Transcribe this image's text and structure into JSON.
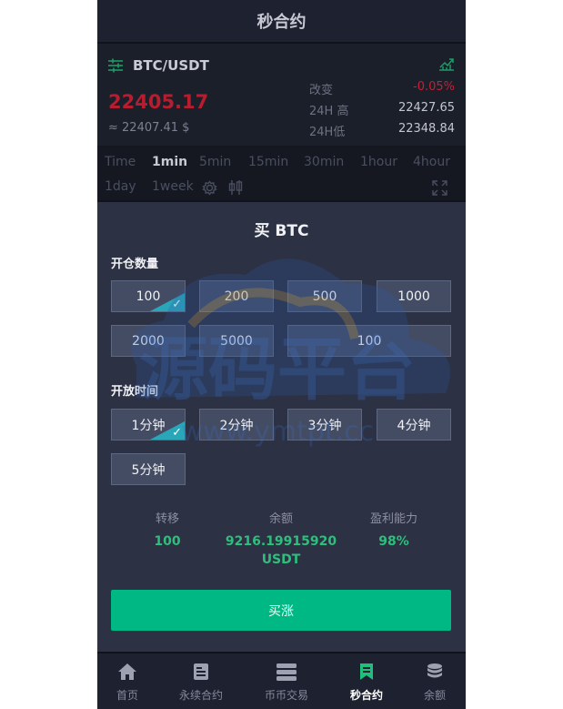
{
  "header": {
    "title": "秒合约"
  },
  "market": {
    "pair": "BTC/USDT",
    "price": "22405.17",
    "approx": "≈ 22407.41 $",
    "change_label": "改变",
    "change_value": "-0.05%",
    "high_label": "24H 高",
    "high_value": "22427.65",
    "low_label": "24H低",
    "low_value": "22348.84"
  },
  "timeframes": {
    "items": [
      "Time",
      "1min",
      "5min",
      "15min",
      "30min",
      "1hour",
      "4hour",
      "1day",
      "1week"
    ],
    "active": "1min"
  },
  "buy_panel": {
    "title": "买 BTC",
    "quantity_label": "开仓数量",
    "quantity_options": [
      "100",
      "200",
      "500",
      "1000",
      "2000",
      "5000",
      "100"
    ],
    "quantity_selected": "100",
    "time_label": "开放时间",
    "time_options": [
      "1分钟",
      "2分钟",
      "3分钟",
      "4分钟",
      "5分钟"
    ],
    "time_selected": "1分钟",
    "info": {
      "transfer_label": "转移",
      "transfer_value": "100",
      "balance_label": "余额",
      "balance_value": "9216.19915920",
      "balance_unit": "USDT",
      "profit_label": "盈利能力",
      "profit_value": "98%"
    },
    "buy_button": "买涨"
  },
  "bottom_nav": {
    "items": [
      "首页",
      "永续合约",
      "币币交易",
      "秒合约",
      "余额"
    ],
    "active": "秒合约"
  },
  "watermark": {
    "text": "源码平台",
    "url": "www.ymtpt.cc"
  },
  "colors": {
    "up": "#00b883",
    "down": "#c81f33",
    "panel": "#2c3143",
    "option": "#434c63",
    "check": "#2aa6b9"
  }
}
